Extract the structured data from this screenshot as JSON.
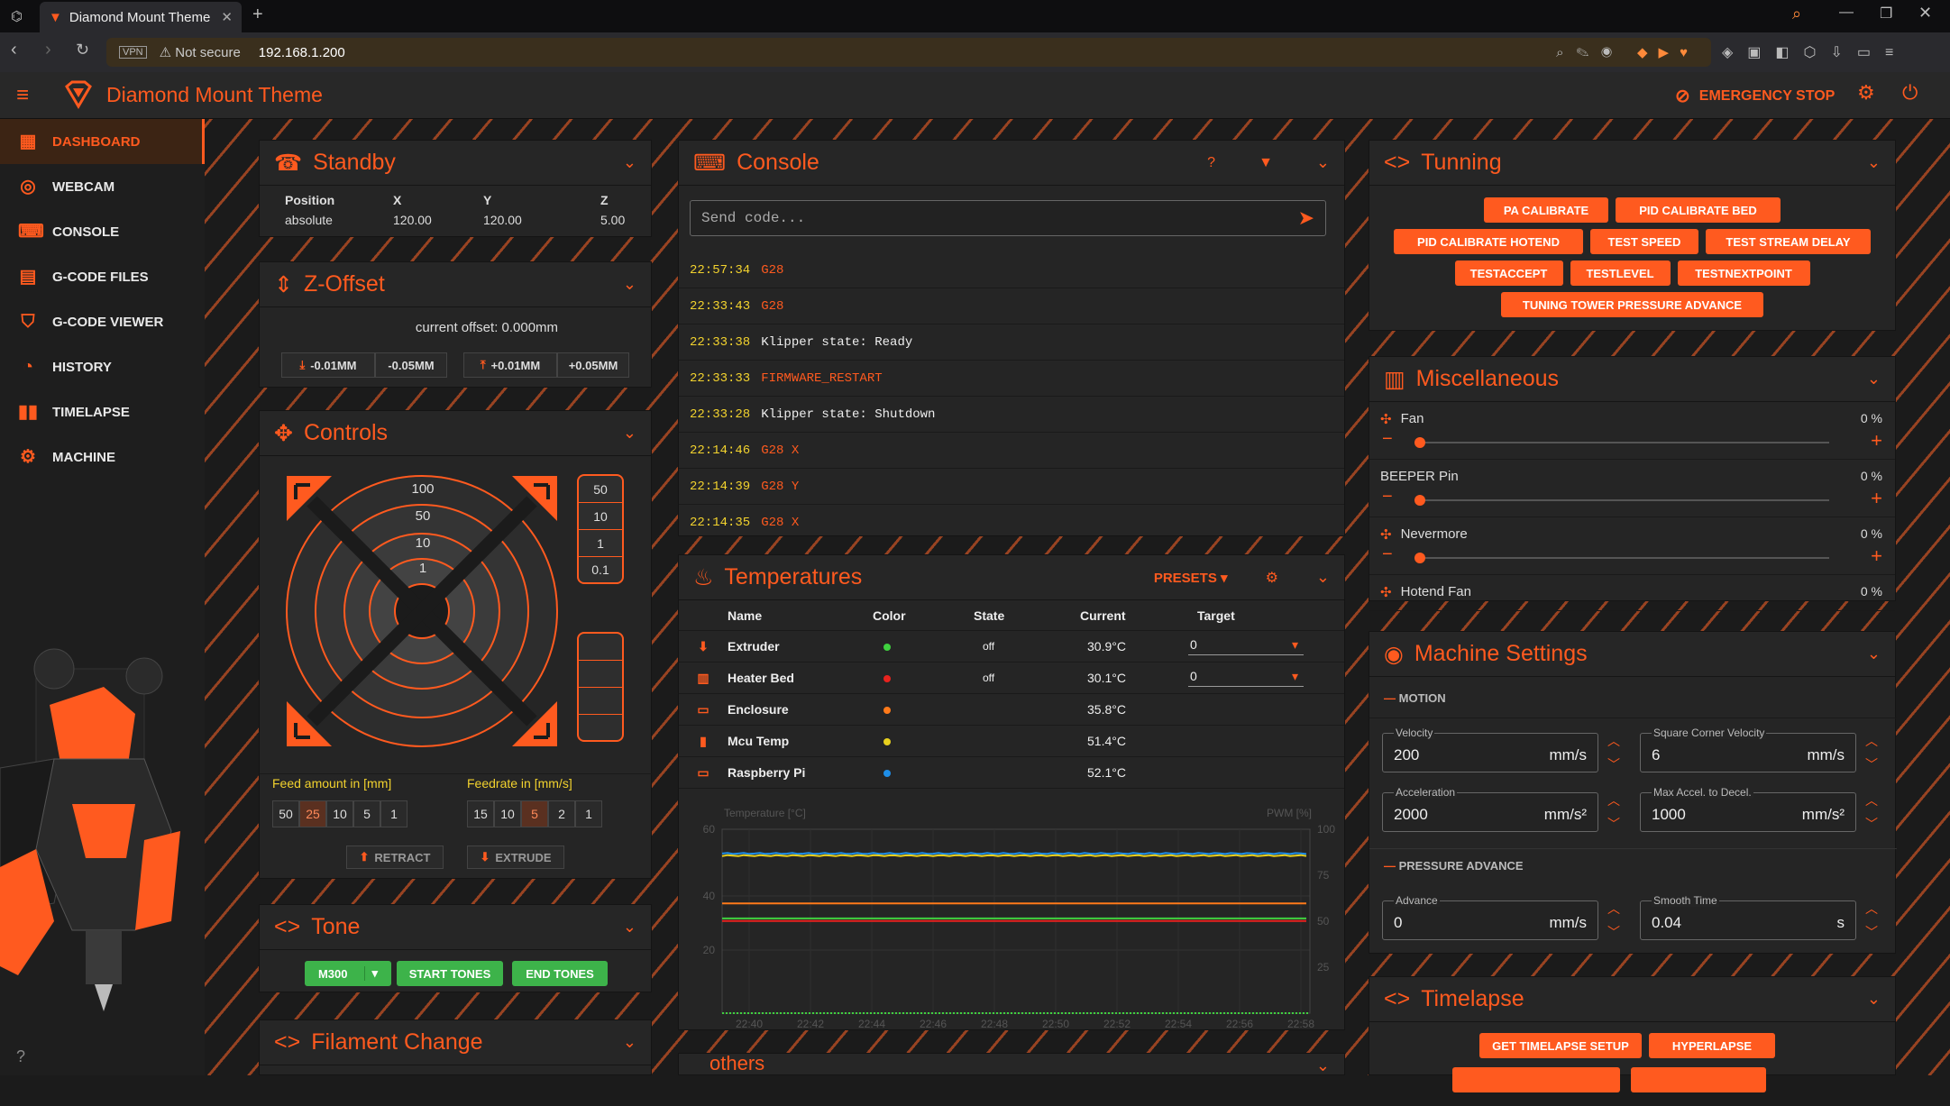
{
  "browser": {
    "tab_title": "Diamond Mount Theme",
    "vpn": "VPN",
    "security": "Not secure",
    "url": "192.168.1.200"
  },
  "app": {
    "title": "Diamond Mount Theme",
    "emergency": "EMERGENCY STOP"
  },
  "nav": [
    {
      "label": "DASHBOARD",
      "icon": "dashboard-icon"
    },
    {
      "label": "WEBCAM",
      "icon": "webcam-icon"
    },
    {
      "label": "CONSOLE",
      "icon": "console-icon"
    },
    {
      "label": "G-CODE FILES",
      "icon": "files-icon"
    },
    {
      "label": "G-CODE VIEWER",
      "icon": "viewer-icon"
    },
    {
      "label": "HISTORY",
      "icon": "history-icon"
    },
    {
      "label": "TIMELAPSE",
      "icon": "timelapse-icon"
    },
    {
      "label": "MACHINE",
      "icon": "machine-icon"
    }
  ],
  "standby": {
    "title": "Standby",
    "cols": [
      "Position",
      "X",
      "Y",
      "Z"
    ],
    "vals": [
      "absolute",
      "120.00",
      "120.00",
      "5.00"
    ]
  },
  "zoffset": {
    "title": "Z-Offset",
    "current": "current offset: 0.000mm",
    "down": [
      "-0.01MM",
      "-0.05MM"
    ],
    "up": [
      "+0.01MM",
      "+0.05MM"
    ]
  },
  "controls": {
    "title": "Controls",
    "rings": [
      "100",
      "50",
      "10",
      "1"
    ],
    "zsteps": [
      "50",
      "10",
      "1",
      "0.1"
    ],
    "feed_label": "Feed amount in [mm]",
    "feedrate_label": "Feedrate in [mm/s]",
    "feed": [
      "50",
      "25",
      "10",
      "5",
      "1"
    ],
    "feedrate": [
      "15",
      "10",
      "5",
      "2",
      "1"
    ],
    "retract": "RETRACT",
    "extrude": "EXTRUDE"
  },
  "tone": {
    "title": "Tone",
    "m300": "M300",
    "start": "START TONES",
    "end": "END TONES"
  },
  "filament": {
    "title": "Filament Change"
  },
  "console": {
    "title": "Console",
    "placeholder": "Send code...",
    "rows": [
      {
        "t": "22:57:34",
        "m": "G28",
        "type": "cmd"
      },
      {
        "t": "22:33:43",
        "m": "G28",
        "type": "cmd"
      },
      {
        "t": "22:33:38",
        "m": "Klipper state: Ready",
        "type": "msg"
      },
      {
        "t": "22:33:33",
        "m": "FIRMWARE_RESTART",
        "type": "cmd"
      },
      {
        "t": "22:33:28",
        "m": "Klipper state: Shutdown",
        "type": "msg"
      },
      {
        "t": "22:14:46",
        "m": "G28 X",
        "type": "cmd"
      },
      {
        "t": "22:14:39",
        "m": "G28 Y",
        "type": "cmd"
      },
      {
        "t": "22:14:35",
        "m": "G28 X",
        "type": "cmd"
      }
    ]
  },
  "temps": {
    "title": "Temperatures",
    "presets": "PRESETS",
    "cols": [
      "Name",
      "Color",
      "State",
      "Current",
      "Target"
    ],
    "rows": [
      {
        "name": "Extruder",
        "color": "#3fd13f",
        "state": "off",
        "current": "30.9°C",
        "target": "0"
      },
      {
        "name": "Heater Bed",
        "color": "#e8231e",
        "state": "off",
        "current": "30.1°C",
        "target": "0"
      },
      {
        "name": "Enclosure",
        "color": "#ff7a1a",
        "state": "",
        "current": "35.8°C",
        "target": ""
      },
      {
        "name": "Mcu Temp",
        "color": "#e8d01e",
        "state": "",
        "current": "51.4°C",
        "target": ""
      },
      {
        "name": "Raspberry Pi",
        "color": "#1e8ee8",
        "state": "",
        "current": "52.1°C",
        "target": ""
      }
    ],
    "ylabel": "Temperature [°C]",
    "y2label": "PWM [%]",
    "yticks": [
      "60",
      "40",
      "20"
    ],
    "y2ticks": [
      "100",
      "75",
      "50",
      "25"
    ],
    "xticks": [
      "22:40",
      "22:42",
      "22:44",
      "22:46",
      "22:48",
      "22:50",
      "22:52",
      "22:54",
      "22:56",
      "22:58"
    ]
  },
  "others": {
    "title": "others"
  },
  "tuning": {
    "title": "Tunning",
    "buttons": [
      [
        "PA CALIBRATE",
        "PID CALIBRATE BED"
      ],
      [
        "PID CALIBRATE HOTEND",
        "TEST SPEED",
        "TEST STREAM DELAY"
      ],
      [
        "TESTACCEPT",
        "TESTLEVEL",
        "TESTNEXTPOINT"
      ],
      [
        "TUNING TOWER PRESSURE ADVANCE"
      ]
    ]
  },
  "misc": {
    "title": "Miscellaneous",
    "items": [
      {
        "name": "Fan",
        "val": "0 %"
      },
      {
        "name": "BEEPER Pin",
        "val": "0 %"
      },
      {
        "name": "Nevermore",
        "val": "0 %"
      },
      {
        "name": "Hotend Fan",
        "val": "0 %"
      }
    ]
  },
  "machine": {
    "title": "Machine Settings",
    "motion": "MOTION",
    "pa": "PRESSURE ADVANCE",
    "fields": [
      {
        "label": "Velocity",
        "val": "200",
        "unit": "mm/s"
      },
      {
        "label": "Square Corner Velocity",
        "val": "6",
        "unit": "mm/s"
      },
      {
        "label": "Acceleration",
        "val": "2000",
        "unit": "mm/s²"
      },
      {
        "label": "Max Accel. to Decel.",
        "val": "1000",
        "unit": "mm/s²"
      },
      {
        "label": "Advance",
        "val": "0",
        "unit": "mm/s"
      },
      {
        "label": "Smooth Time",
        "val": "0.04",
        "unit": "s"
      }
    ]
  },
  "timelapse": {
    "title": "Timelapse",
    "get": "GET TIMELAPSE SETUP",
    "hyper": "HYPERLAPSE"
  }
}
